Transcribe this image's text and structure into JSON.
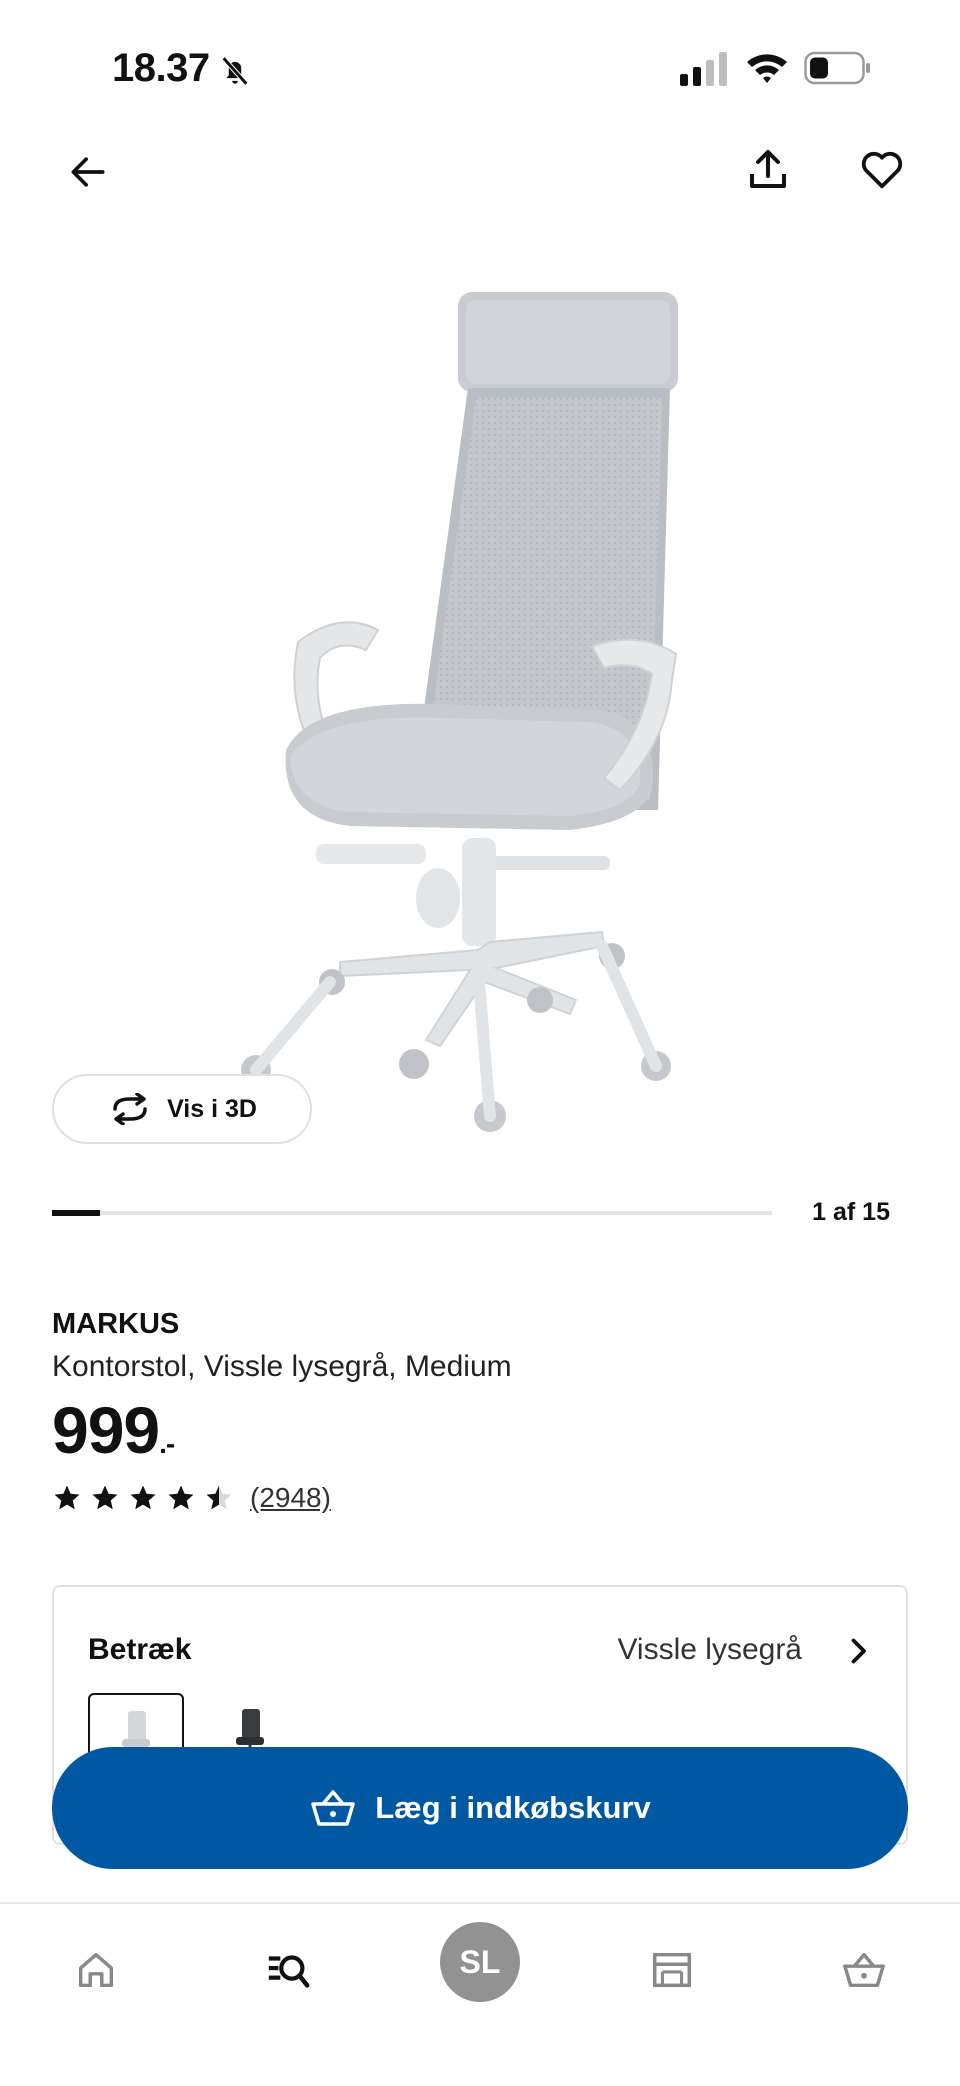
{
  "status_bar": {
    "time": "18.37",
    "icons": [
      "bell-off-icon",
      "signal-icon",
      "wifi-icon",
      "battery-icon"
    ]
  },
  "top_nav": {
    "icons": [
      "back-arrow-icon",
      "share-icon",
      "heart-icon"
    ]
  },
  "gallery": {
    "view_3d_label": "Vis i 3D",
    "counter": "1 af 15",
    "current_index": 1,
    "total_images": 15
  },
  "product": {
    "name": "MARKUS",
    "description": "Kontorstol, Vissle lysegrå, Medium",
    "price": "999",
    "price_suffix": ".-",
    "rating": 4.5,
    "rating_max": 5,
    "review_count": "(2948)"
  },
  "variant": {
    "title": "Betræk",
    "selected": "Vissle lysegrå",
    "swatches": [
      "light-grey-chair-swatch",
      "dark-grey-chair-swatch"
    ]
  },
  "cta": {
    "label": "Læg i indkøbskurv"
  },
  "bottom_nav": {
    "profile_initials": "SL",
    "tabs": [
      "home-icon",
      "search-icon",
      "profile-avatar",
      "store-icon",
      "cart-icon"
    ]
  },
  "colors": {
    "primary_blue": "#0058a3",
    "text": "#111111",
    "avatar_grey": "#929292"
  }
}
